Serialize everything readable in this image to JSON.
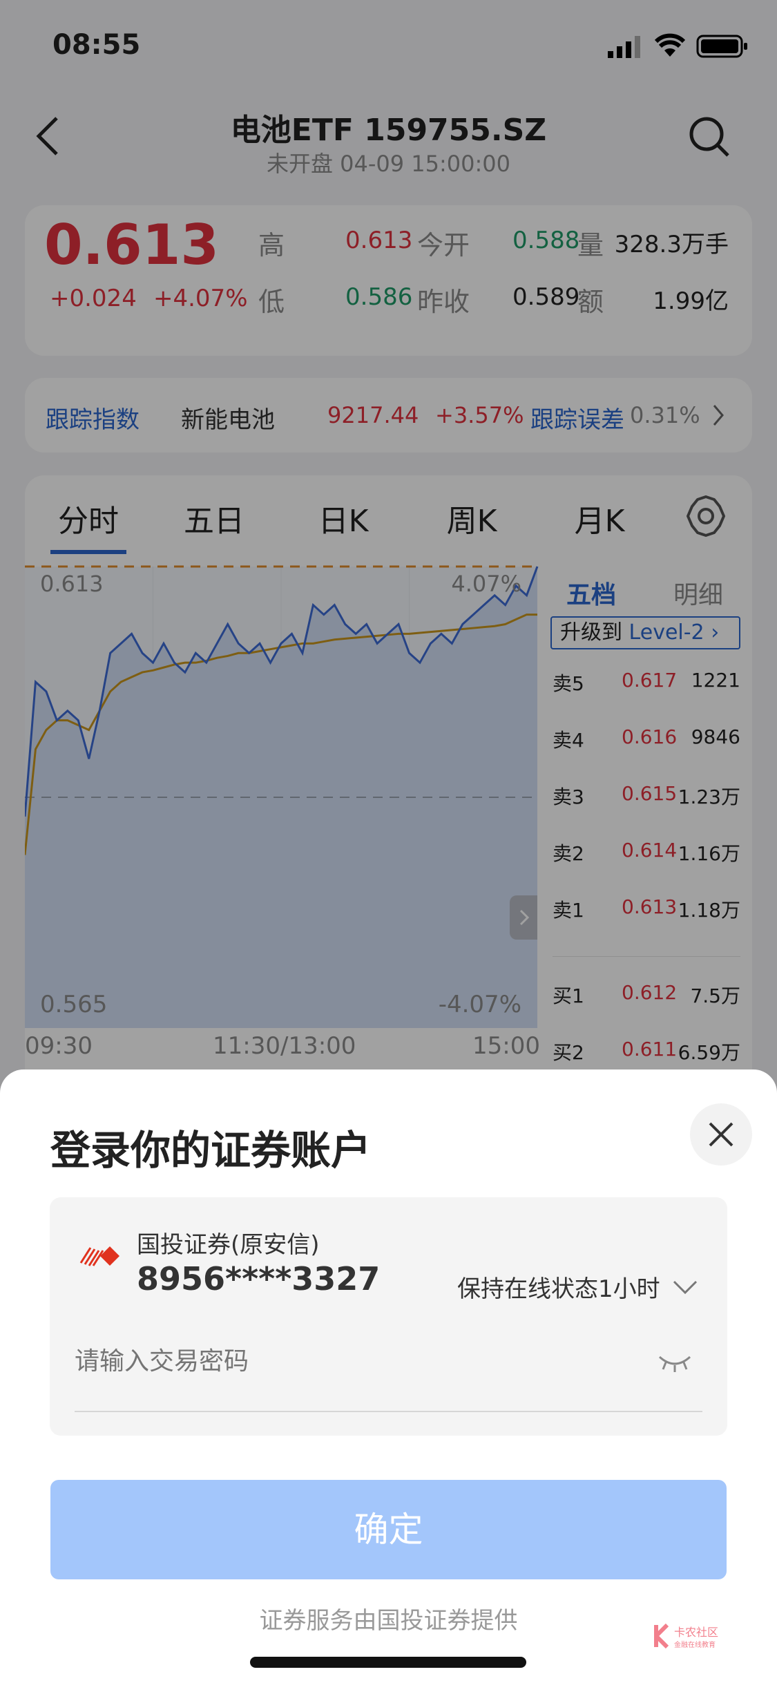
{
  "status_bar": {
    "time": "08:55",
    "icons": [
      "cellular-signal-icon",
      "wifi-icon",
      "battery-icon"
    ]
  },
  "header": {
    "title": "电池ETF 159755.SZ",
    "subtitle": "未开盘 04-09 15:00:00",
    "back_icon": "chevron-left-icon",
    "search_icon": "search-icon"
  },
  "quote": {
    "price": "0.613",
    "change": "+0.024",
    "change_pct": "+4.07%",
    "high_label": "高",
    "high": "0.613",
    "low_label": "低",
    "low": "0.586",
    "open_label": "今开",
    "open": "0.588",
    "prev_close_label": "昨收",
    "prev_close": "0.589",
    "volume_label": "量",
    "volume": "328.3万手",
    "amount_label": "额",
    "amount": "1.99亿"
  },
  "index_row": {
    "label": "跟踪指数",
    "name": "新能电池",
    "value": "9217.44",
    "change_pct": "+3.57%",
    "error_label": "跟踪误差",
    "error": "0.31%"
  },
  "tabs": [
    "分时",
    "五日",
    "日K",
    "周K",
    "月K"
  ],
  "active_tab": 0,
  "orderbook": {
    "tabs": [
      "五档",
      "明细"
    ],
    "upgrade_prefix": "升级到 ",
    "upgrade_level": "Level-2",
    "asks": [
      {
        "label": "卖5",
        "price": "0.617",
        "vol": "1221"
      },
      {
        "label": "卖4",
        "price": "0.616",
        "vol": "9846"
      },
      {
        "label": "卖3",
        "price": "0.615",
        "vol": "1.23万"
      },
      {
        "label": "卖2",
        "price": "0.614",
        "vol": "1.16万"
      },
      {
        "label": "卖1",
        "price": "0.613",
        "vol": "1.18万"
      }
    ],
    "bids": [
      {
        "label": "买1",
        "price": "0.612",
        "vol": "7.5万"
      },
      {
        "label": "买2",
        "price": "0.611",
        "vol": "6.59万"
      }
    ]
  },
  "chart_data": {
    "type": "line",
    "y_top_label": "0.613",
    "y_bottom_label": "0.565",
    "pct_top_label": "4.07%",
    "pct_bottom_label": "-4.07%",
    "ylim": [
      0.565,
      0.613
    ],
    "prev_close": 0.589,
    "x_tick_labels": [
      "09:30",
      "11:30/13:00",
      "15:00"
    ],
    "times": [
      "09:30",
      "09:35",
      "09:40",
      "09:45",
      "09:50",
      "09:55",
      "10:00",
      "10:05",
      "10:10",
      "10:15",
      "10:20",
      "10:25",
      "10:30",
      "10:35",
      "10:40",
      "10:45",
      "10:50",
      "10:55",
      "11:00",
      "11:05",
      "11:10",
      "11:15",
      "11:20",
      "11:25",
      "11:30",
      "13:05",
      "13:10",
      "13:15",
      "13:20",
      "13:25",
      "13:30",
      "13:35",
      "13:40",
      "13:45",
      "13:50",
      "13:55",
      "14:00",
      "14:05",
      "14:10",
      "14:15",
      "14:20",
      "14:25",
      "14:30",
      "14:35",
      "14:40",
      "14:45",
      "14:50",
      "14:55",
      "15:00"
    ],
    "series": [
      {
        "values": [
          0.587,
          0.601,
          0.6,
          0.597,
          0.598,
          0.597,
          0.593,
          0.598,
          0.604,
          0.605,
          0.606,
          0.604,
          0.603,
          0.605,
          0.603,
          0.602,
          0.604,
          0.603,
          0.605,
          0.607,
          0.605,
          0.604,
          0.605,
          0.603,
          0.605,
          0.606,
          0.604,
          0.609,
          0.608,
          0.609,
          0.607,
          0.606,
          0.607,
          0.605,
          0.606,
          0.607,
          0.604,
          0.603,
          0.605,
          0.606,
          0.605,
          0.607,
          0.608,
          0.609,
          0.61,
          0.609,
          0.611,
          0.61,
          0.613
        ],
        "color": "#3d6ad4"
      },
      {
        "values": [
          0.583,
          0.594,
          0.596,
          0.597,
          0.597,
          0.5965,
          0.596,
          0.598,
          0.6,
          0.601,
          0.6015,
          0.602,
          0.6022,
          0.6025,
          0.6028,
          0.603,
          0.603,
          0.6032,
          0.6035,
          0.6037,
          0.604,
          0.604,
          0.6042,
          0.6044,
          0.6046,
          0.6048,
          0.605,
          0.605,
          0.6052,
          0.6054,
          0.6055,
          0.6056,
          0.6057,
          0.6058,
          0.6059,
          0.606,
          0.606,
          0.6061,
          0.6062,
          0.6063,
          0.6064,
          0.6065,
          0.6066,
          0.6067,
          0.6068,
          0.607,
          0.6075,
          0.608,
          0.608
        ],
        "color": "#c8961e"
      }
    ]
  },
  "login_sheet": {
    "title": "登录你的证券账户",
    "broker": "国投证券(原安信)",
    "account": "8956****3327",
    "online": "保持在线状态1小时",
    "password_placeholder": "请输入交易密码",
    "confirm": "确定",
    "footer": "证券服务由国投证券提供",
    "watermark": "卡农社区 金融在线教育"
  },
  "colors": {
    "up": "#e0323f",
    "down": "#1f9a68",
    "accent": "#2c66cc",
    "confirm_button": "#a3c6fb"
  }
}
